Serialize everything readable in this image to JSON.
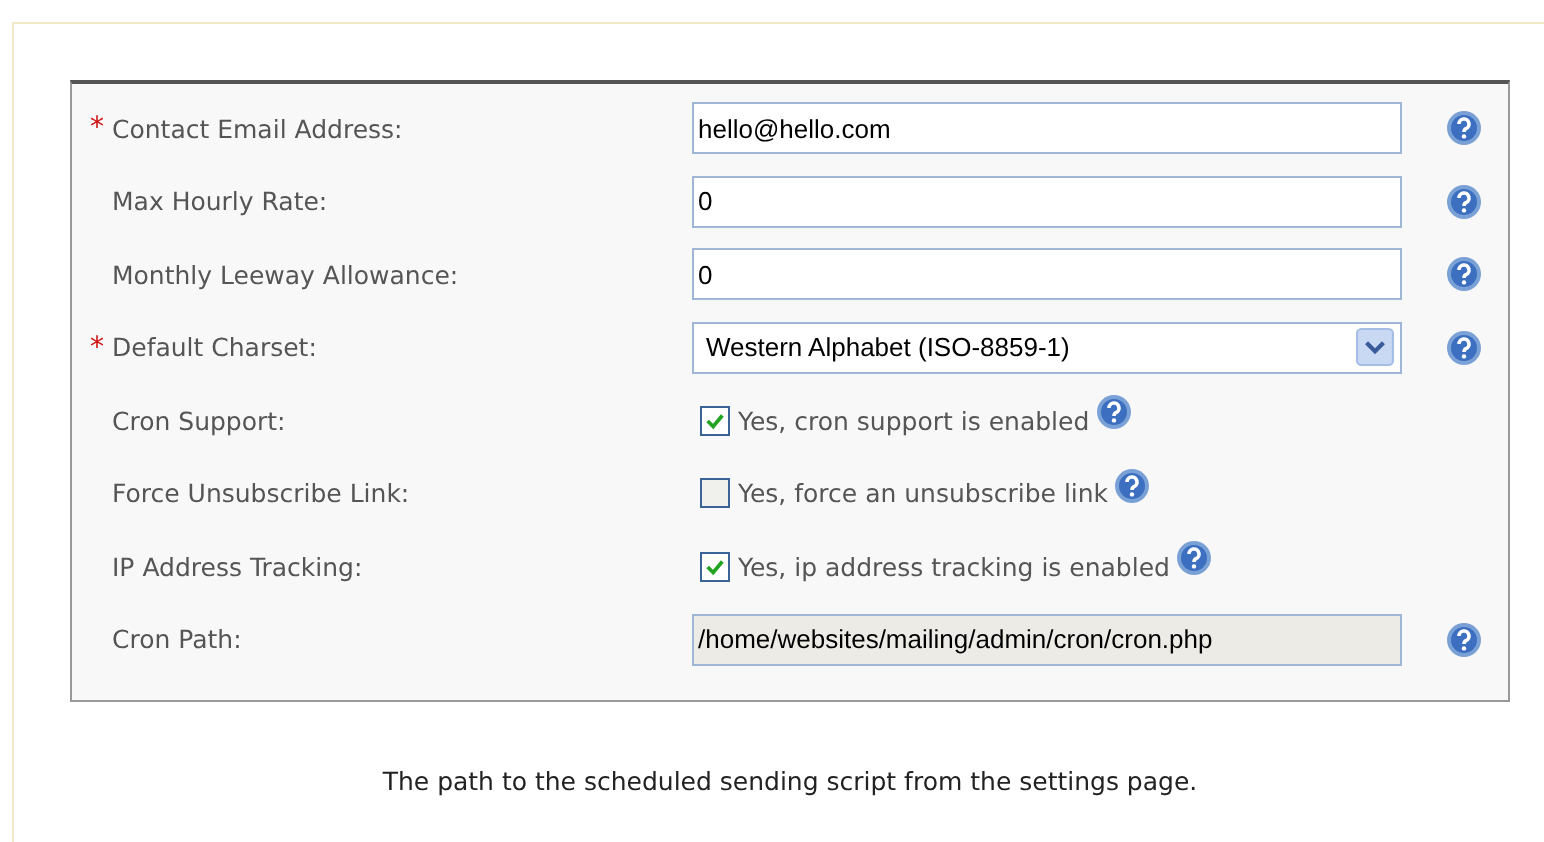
{
  "fields": [
    {
      "kind": "text",
      "label": "Contact Email Address:",
      "required_mark": "*",
      "value": "hello@hello.com"
    },
    {
      "kind": "text",
      "label": "Max Hourly Rate:",
      "value": "0"
    },
    {
      "kind": "text",
      "label": "Monthly Leeway Allowance:",
      "value": "0"
    },
    {
      "kind": "select",
      "label": "Default Charset:",
      "required_mark": "*",
      "value": "Western Alphabet (ISO-8859-1)"
    },
    {
      "kind": "checkbox",
      "label": "Cron Support:",
      "checked": true,
      "text": "Yes, cron support is enabled"
    },
    {
      "kind": "checkbox",
      "label": "Force Unsubscribe Link:",
      "checked": false,
      "text": "Yes, force an unsubscribe link"
    },
    {
      "kind": "checkbox",
      "label": "IP Address Tracking:",
      "checked": true,
      "text": "Yes, ip address tracking is enabled"
    },
    {
      "kind": "readonly",
      "label": "Cron Path:",
      "value": "/home/websites/mailing/admin/cron/cron.php"
    }
  ],
  "help_text": "The path to the scheduled sending script from the settings page."
}
